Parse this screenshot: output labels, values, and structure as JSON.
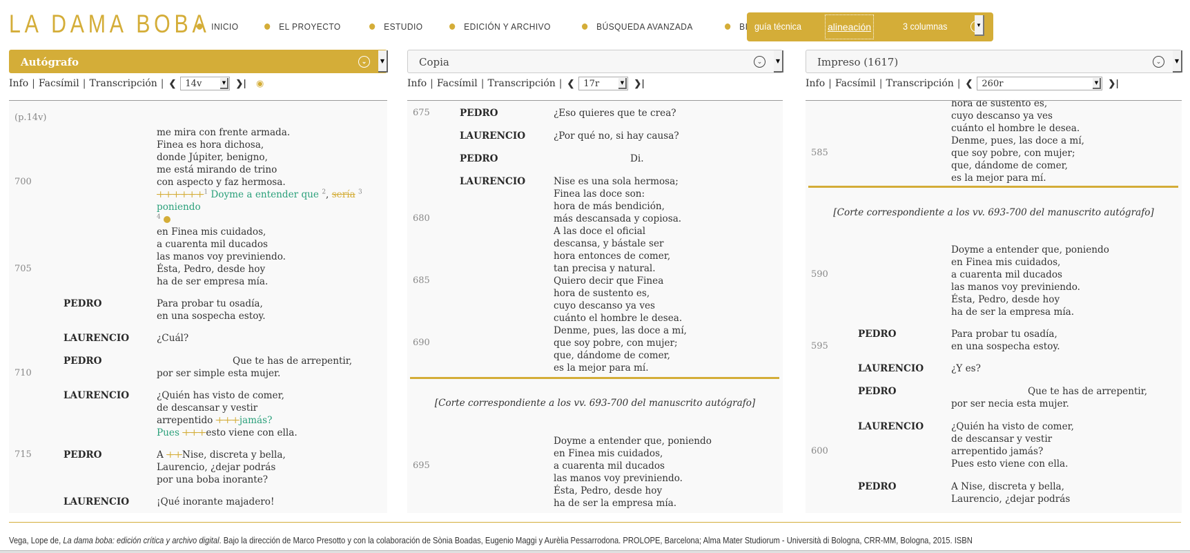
{
  "header": {
    "logo": "LA DAMA BOBA",
    "nav": [
      "INICIO",
      "EL PROYECTO",
      "ESTUDIO",
      "EDICIÓN Y ARCHIVO",
      "BÚSQUEDA AVANZADA",
      "BIBLIOGRAFÍA"
    ],
    "toolbox": {
      "guia": "guía técnica",
      "alineacion": "alineación",
      "columnas": "3 columnas"
    }
  },
  "colors": {
    "accent": "#d4ad38",
    "variant_green": "#2aa07a"
  },
  "subnav": {
    "info": "Info",
    "facsimil": "Facsímil",
    "transcripcion": "Transcripción",
    "sep": "|"
  },
  "columns": [
    {
      "witness": "Autógrafo",
      "page": "14v",
      "page_marker": "(p.14v)",
      "line_numbers": [
        "700",
        "705",
        "710",
        "715"
      ],
      "verses": {
        "a1": "me mira con frente armada.",
        "a2": "Finea es hora dichosa,",
        "a3": "donde Júpiter, benigno,",
        "a4": "me está mirando de trino",
        "a5": "con aspecto y faz hermosa.",
        "a6_del1": "++++++",
        "a6_sup1": "1",
        "a6_ins": "Doyme a entender que",
        "a6_sup2": "2",
        "a6_comma": ",",
        "a6_del2": "sería",
        "a6_sup3": "3",
        "a7_ins": "poniendo",
        "a8_sup4": "4",
        "a9": "en Finea mis cuidados,",
        "a10": "a cuarenta mil ducados",
        "a11": "las manos voy previniendo.",
        "a12": "Ésta, Pedro, desde hoy",
        "a13": "ha de ser empresa mía.",
        "b_speaker": "PEDRO",
        "b1": "Para probar tu osadía,",
        "b2": "en una sospecha estoy.",
        "c_speaker": "LAURENCIO",
        "c1": "¿Cuál?",
        "d_speaker": "PEDRO",
        "d1": "Que te has de arrepentir,",
        "d2": "por ser simple esta mujer.",
        "e_speaker": "LAURENCIO",
        "e1": "¿Quién has visto de comer,",
        "e2": "de descansar y vestir",
        "e3_pre": "arrepentido ",
        "e3_del": "+++",
        "e3_ins": "jamás?",
        "e4_ins": "Pues ",
        "e4_del": "+++",
        "e4_post": "esto viene con ella.",
        "f_speaker": "PEDRO",
        "f1_pre": "A ",
        "f1_del": "++",
        "f1_post": "Nise, discreta y bella,",
        "f2": "Laurencio, ¿dejar podrás",
        "f3": "por una boba inorante?",
        "g_speaker": "LAURENCIO",
        "g1": "¡Qué inorante majadero!"
      }
    },
    {
      "witness": "Copia",
      "page": "17r",
      "line_numbers": [
        "675",
        "680",
        "685",
        "690",
        "695"
      ],
      "verses": {
        "s1": "PEDRO",
        "v1": "¿Eso quieres que te crea?",
        "s2": "LAURENCIO",
        "v2": "¿Por qué no, si hay causa?",
        "s3": "PEDRO",
        "v3": "Di.",
        "s4": "LAURENCIO",
        "v4": [
          "Nise es una sola hermosa;",
          "Finea las doce son:",
          "hora de más bendición,",
          "más descansada y copiosa.",
          "A las doce el oficial",
          "descansa, y bástale ser",
          "hora entonces de comer,",
          "tan precisa y natural.",
          "Quiero decir que Finea",
          "hora de sustento es,",
          "cuyo descanso ya ves",
          "cuánto el hombre le desea.",
          "Denme, pues, las doce a mí,",
          "que soy pobre, con mujer;",
          "que, dándome de comer,",
          "es la mejor para mí."
        ],
        "corte": "[Corte correspondiente a los vv. 693-700 del manuscrito autógrafo]",
        "v5": [
          "Doyme a entender que, poniendo",
          "en Finea mis cuidados,",
          "a cuarenta mil ducados",
          "las manos voy previniendo.",
          "Ésta, Pedro, desde hoy",
          "ha de ser la empresa mía."
        ]
      }
    },
    {
      "witness": "Impreso (1617)",
      "page": "260r",
      "line_numbers": [
        "585",
        "590",
        "595",
        "600"
      ],
      "verses": {
        "v0": [
          "hora de sustento es,",
          "cuyo descanso ya ves",
          "cuánto el hombre le desea.",
          "Denme, pues, las doce a mí,",
          "que soy pobre, con mujer;",
          "que, dándome de comer,",
          "es la mejor para mí."
        ],
        "corte": "[Corte correspondiente a los vv. 693-700 del manuscrito autógrafo]",
        "v1": [
          "Doyme a entender que, poniendo",
          "en Finea mis cuidados,",
          "a cuarenta mil ducados",
          "las manos voy previniendo.",
          "Ésta, Pedro, desde hoy",
          "ha de ser la empresa mía."
        ],
        "s2": "PEDRO",
        "v2": [
          "Para probar tu osadía,",
          "en una sospecha estoy."
        ],
        "s3": "LAURENCIO",
        "v3": "¿Y es?",
        "s4": "PEDRO",
        "v4": [
          "Que te has de arrepentir,",
          "por ser necia esta mujer."
        ],
        "s5": "LAURENCIO",
        "v5": [
          "¿Quién ha visto de comer,",
          "de descansar y vestir",
          "arrepentido jamás?",
          "Pues esto viene con ella."
        ],
        "s6": "PEDRO",
        "v6": [
          "A Nise, discreta y bella,",
          "Laurencio, ¿dejar podrás"
        ]
      }
    }
  ],
  "footer": {
    "pre": "Vega, Lope de, ",
    "title": "La dama boba: edición crítica y archivo digital",
    "post": ". Bajo la dirección de Marco Presotto y con la colaboración de Sònia Boadas, Eugenio Maggi y Aurèlia Pessarrodona. PROLOPE, Barcelona; Alma Mater Studiorum - Università di Bologna, CRR-MM, Bologna, 2015. ISBN"
  }
}
